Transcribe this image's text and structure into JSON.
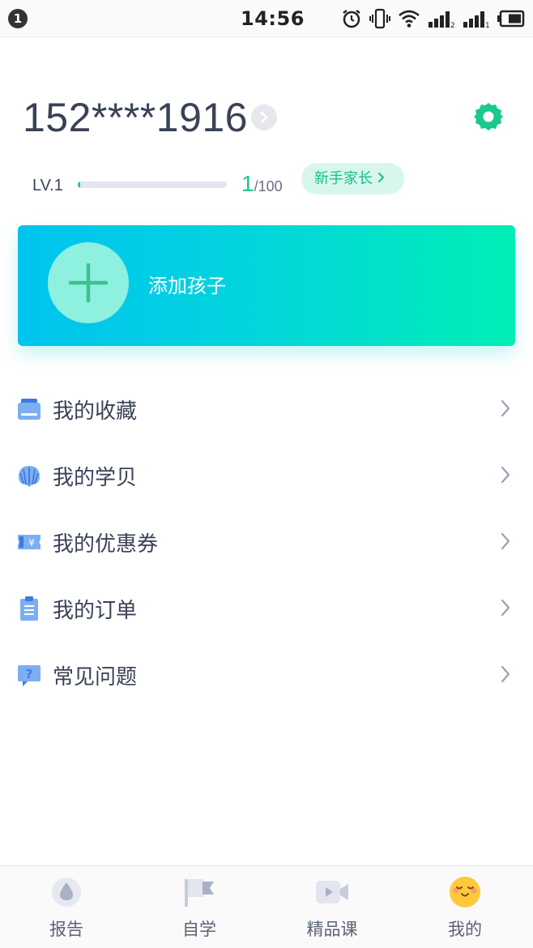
{
  "status_bar": {
    "notification_count": "1",
    "time": "14:56"
  },
  "profile": {
    "phone": "152****1916",
    "level": "LV.1",
    "progress_current": "1",
    "progress_max": "/100",
    "progress_fraction": 0.01,
    "title_badge": "新手家长"
  },
  "add_child": {
    "label": "添加孩子"
  },
  "menu": {
    "items": [
      {
        "label": "我的收藏",
        "icon": "folder-icon"
      },
      {
        "label": "我的学贝",
        "icon": "shell-icon"
      },
      {
        "label": "我的优惠券",
        "icon": "coupon-icon"
      },
      {
        "label": "我的订单",
        "icon": "clipboard-icon"
      },
      {
        "label": "常见问题",
        "icon": "question-bubble-icon"
      }
    ]
  },
  "bottom_nav": {
    "items": [
      {
        "label": "报告",
        "icon": "drop-icon",
        "active": false
      },
      {
        "label": "自学",
        "icon": "flag-icon",
        "active": false
      },
      {
        "label": "精品课",
        "icon": "video-icon",
        "active": false
      },
      {
        "label": "我的",
        "icon": "smiley-icon",
        "active": true
      }
    ]
  },
  "colors": {
    "accent_green": "#19c98e",
    "card_gradient_start": "#00c3ee",
    "card_gradient_end": "#00eeb5",
    "text_primary": "#3a4257",
    "icon_blue": "#6aa2f0"
  }
}
